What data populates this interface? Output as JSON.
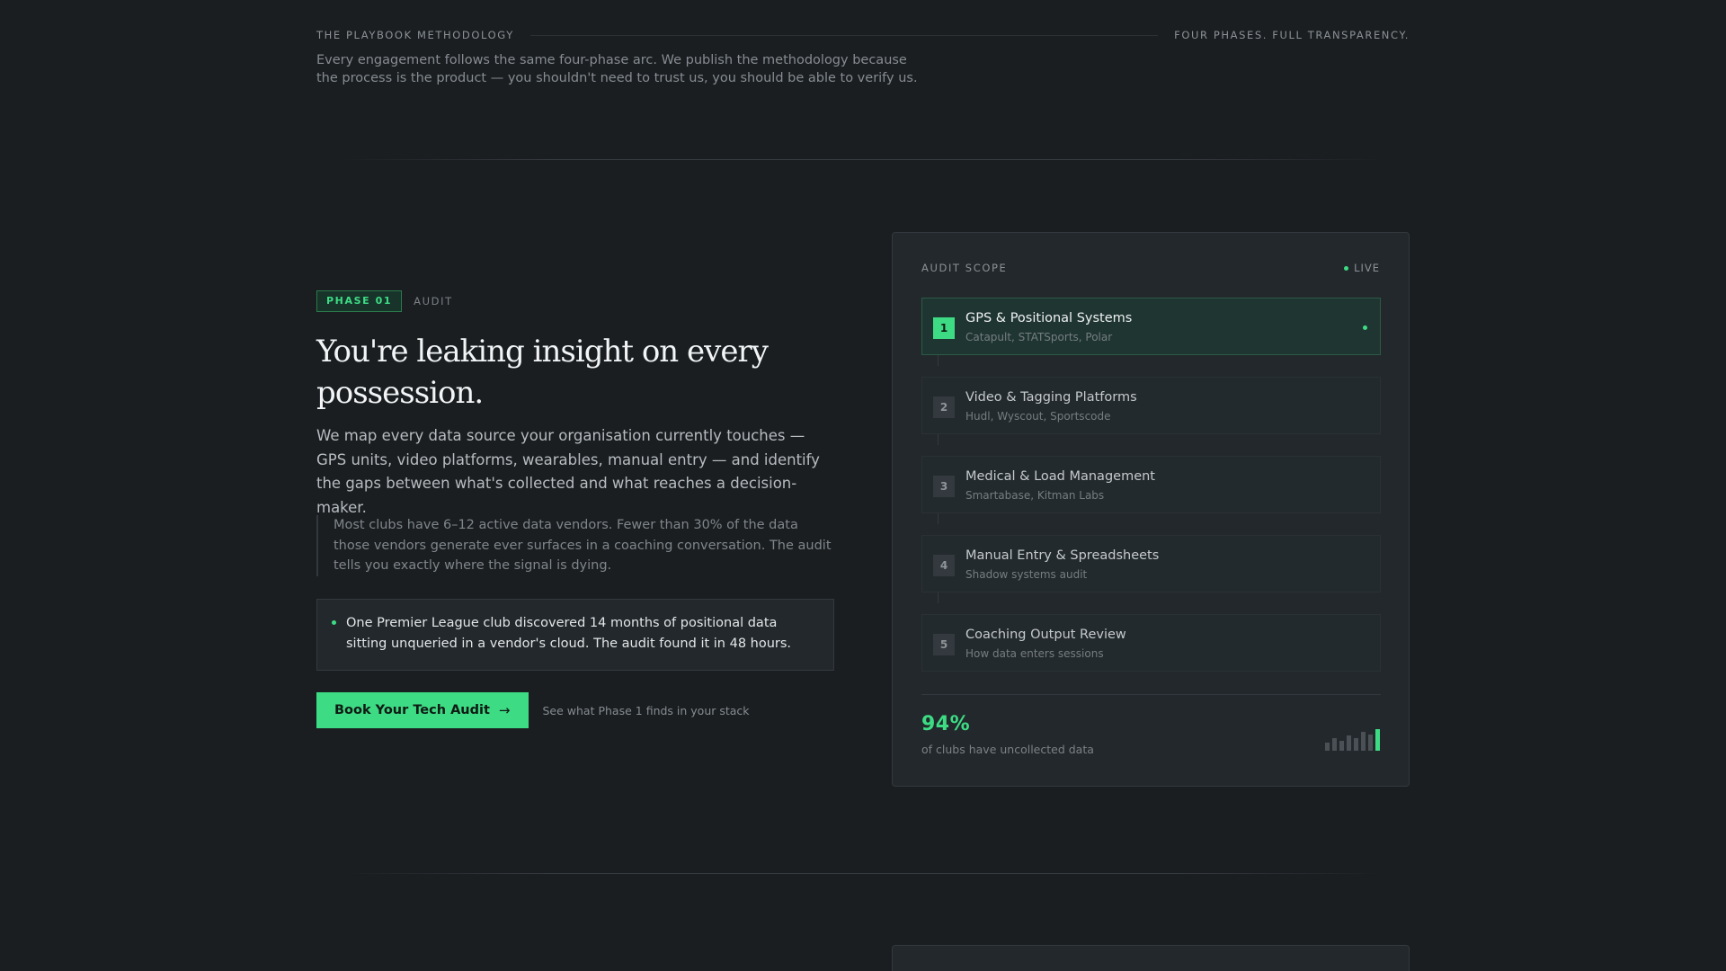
{
  "methodology": {
    "eyebrow_left": "THE PLAYBOOK METHODOLOGY",
    "eyebrow_right": "FOUR PHASES. FULL TRANSPARENCY.",
    "description": "Every engagement follows the same four-phase arc. We publish the methodology because the process is the product — you shouldn't need to trust us, you should be able to verify us."
  },
  "phase": {
    "badge": "PHASE 01",
    "name": "AUDIT",
    "headline": "You're leaking insight on every possession.",
    "lede": "We map every data source your organisation currently touches — GPS units, video platforms, wearables, manual entry — and identify the gaps between what's collected and what reaches a decision-maker.",
    "quote": "Most clubs have 6–12 active data vendors. Fewer than 30% of the data those vendors generate ever surfaces in a coaching conversation. The audit tells you exactly where the signal is dying.",
    "callout": "One Premier League club discovered 14 months of positional data sitting unqueried in a vendor's cloud. The audit found it in 48 hours.",
    "cta_label": "Book Your Tech Audit",
    "cta_note": "See what Phase 1 finds in your stack"
  },
  "audit_panel": {
    "title": "AUDIT SCOPE",
    "status": "LIVE",
    "items": [
      {
        "num": "1",
        "title": "GPS & Positional Systems",
        "sub": "Catapult, STATSports, Polar",
        "active": true
      },
      {
        "num": "2",
        "title": "Video & Tagging Platforms",
        "sub": "Hudl, Wyscout, Sportscode",
        "active": false
      },
      {
        "num": "3",
        "title": "Medical & Load Management",
        "sub": "Smartabase, Kitman Labs",
        "active": false
      },
      {
        "num": "4",
        "title": "Manual Entry & Spreadsheets",
        "sub": "Shadow systems audit",
        "active": false
      },
      {
        "num": "5",
        "title": "Coaching Output Review",
        "sub": "How data enters sessions",
        "active": false
      }
    ],
    "stat_value": "94%",
    "stat_label": "of clubs have uncollected data",
    "sparkline_levels": [
      0.3,
      0.45,
      0.35,
      0.55,
      0.45,
      0.7,
      0.6,
      0.8
    ]
  },
  "colors": {
    "accent": "#3ddc84",
    "background": "#1a1e21",
    "panel": "#22282b"
  }
}
